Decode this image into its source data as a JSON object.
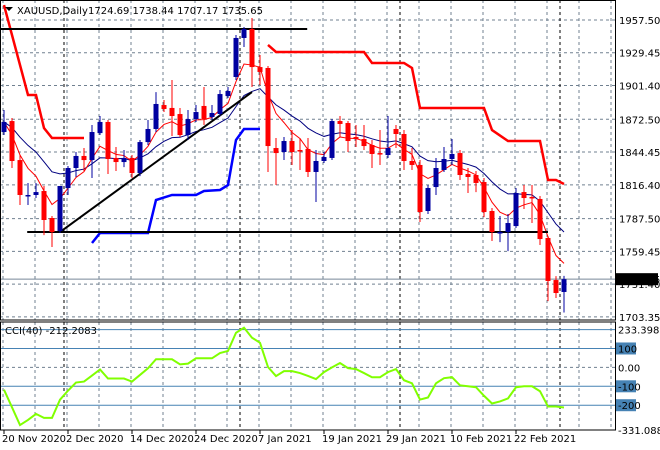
{
  "header": {
    "symbol_label": "XAUUSD,Daily",
    "ohlc": "1724.69 1738.44 1707.17 1735.65"
  },
  "colors": {
    "bull": "#0000a0",
    "bear": "#ff0000",
    "ma_fast": "#ff0000",
    "ma_slow": "#000080",
    "upper_band": "#ff0000",
    "lower_band": "#0000ff",
    "cci": "#80ff00",
    "cci_level": "#4682b4",
    "grid": "#708090"
  },
  "chart_data": [
    {
      "type": "candlestick",
      "title": "XAUUSD,Daily",
      "ylim": [
        1700.7,
        1974.6
      ],
      "y_ticks": [
        "1957.50",
        "1929.45",
        "1901.40",
        "1872.50",
        "1844.45",
        "1816.40",
        "1787.50",
        "1759.45",
        "1731.40",
        "1703.35"
      ],
      "current_price": "1735.65",
      "x_labels": [
        {
          "index": 0,
          "label": "20 Nov 2020"
        },
        {
          "index": 8,
          "label": "2 Dec 2020"
        },
        {
          "index": 16,
          "label": "14 Dec 2020"
        },
        {
          "index": 24,
          "label": "24 Dec 2020"
        },
        {
          "index": 32,
          "label": "7 Jan 2021"
        },
        {
          "index": 40,
          "label": "19 Jan 2021"
        },
        {
          "index": 48,
          "label": "29 Jan 2021"
        },
        {
          "index": 56,
          "label": "10 Feb 2021"
        },
        {
          "index": 64,
          "label": "22 Feb 2021"
        }
      ],
      "period_separators": [
        7,
        29,
        49,
        69
      ],
      "ohlc": [
        [
          1861.6,
          1880.4,
          1859.0,
          1870.2
        ],
        [
          1871.0,
          1873.6,
          1830.8,
          1836.8
        ],
        [
          1837.6,
          1841.9,
          1799.1,
          1807.7
        ],
        [
          1807.7,
          1818.0,
          1799.1,
          1807.7
        ],
        [
          1807.7,
          1818.0,
          1805.1,
          1810.2
        ],
        [
          1811.1,
          1815.4,
          1773.4,
          1786.3
        ],
        [
          1788.0,
          1789.7,
          1763.2,
          1776.0
        ],
        [
          1776.9,
          1815.4,
          1775.2,
          1815.4
        ],
        [
          1813.7,
          1832.5,
          1807.7,
          1830.8
        ],
        [
          1830.8,
          1844.5,
          1823.1,
          1841.1
        ],
        [
          1841.1,
          1847.9,
          1828.2,
          1837.6
        ],
        [
          1837.6,
          1867.6,
          1822.2,
          1861.6
        ],
        [
          1860.7,
          1875.3,
          1859.0,
          1870.2
        ],
        [
          1870.2,
          1871.9,
          1825.7,
          1838.5
        ],
        [
          1839.4,
          1848.8,
          1828.2,
          1835.9
        ],
        [
          1835.9,
          1846.2,
          1831.6,
          1839.4
        ],
        [
          1839.4,
          1841.9,
          1822.2,
          1826.5
        ],
        [
          1826.5,
          1854.8,
          1823.9,
          1853.0
        ],
        [
          1853.0,
          1871.9,
          1850.5,
          1864.2
        ],
        [
          1864.2,
          1895.8,
          1861.6,
          1885.6
        ],
        [
          1884.7,
          1889.0,
          1878.7,
          1881.3
        ],
        [
          1882.2,
          1906.1,
          1858.2,
          1875.3
        ],
        [
          1877.0,
          1882.2,
          1857.3,
          1859.0
        ],
        [
          1859.0,
          1880.4,
          1854.8,
          1872.7
        ],
        [
          1872.7,
          1884.7,
          1870.2,
          1878.7
        ],
        [
          1883.9,
          1900.1,
          1867.6,
          1872.7
        ],
        [
          1874.4,
          1884.7,
          1871.9,
          1877.9
        ],
        [
          1877.0,
          1897.6,
          1875.3,
          1894.1
        ],
        [
          1892.4,
          1900.1,
          1890.7,
          1896.7
        ],
        [
          1908.7,
          1944.6,
          1906.1,
          1942.1
        ],
        [
          1942.1,
          1951.5,
          1934.4,
          1949.8
        ],
        [
          1949.8,
          1959.2,
          1900.1,
          1917.2
        ],
        [
          1917.2,
          1927.5,
          1901.8,
          1913.0
        ],
        [
          1916.4,
          1918.1,
          1827.4,
          1849.6
        ],
        [
          1847.9,
          1856.5,
          1816.2,
          1843.6
        ],
        [
          1844.5,
          1857.3,
          1837.6,
          1853.9
        ],
        [
          1853.9,
          1863.3,
          1833.4,
          1844.5
        ],
        [
          1846.2,
          1856.5,
          1829.1,
          1845.4
        ],
        [
          1847.1,
          1856.5,
          1823.1,
          1827.4
        ],
        [
          1827.4,
          1846.2,
          1801.7,
          1836.8
        ],
        [
          1836.8,
          1844.5,
          1835.1,
          1840.2
        ],
        [
          1839.4,
          1872.7,
          1837.6,
          1871.0
        ],
        [
          1871.0,
          1875.3,
          1857.3,
          1868.5
        ],
        [
          1869.3,
          1871.0,
          1844.5,
          1853.9
        ],
        [
          1857.3,
          1867.6,
          1848.8,
          1855.6
        ],
        [
          1855.6,
          1867.6,
          1846.2,
          1849.6
        ],
        [
          1850.5,
          1854.8,
          1830.8,
          1842.8
        ],
        [
          1843.6,
          1863.3,
          1833.4,
          1842.8
        ],
        [
          1841.9,
          1875.3,
          1839.4,
          1847.9
        ],
        [
          1864.2,
          1867.6,
          1847.9,
          1859.9
        ],
        [
          1859.9,
          1863.3,
          1829.1,
          1836.8
        ],
        [
          1836.8,
          1847.9,
          1829.1,
          1833.4
        ],
        [
          1833.4,
          1837.6,
          1784.6,
          1793.1
        ],
        [
          1794.0,
          1816.2,
          1791.4,
          1813.7
        ],
        [
          1814.5,
          1839.4,
          1807.7,
          1830.8
        ],
        [
          1829.1,
          1848.8,
          1827.4,
          1838.5
        ],
        [
          1838.5,
          1855.6,
          1833.4,
          1842.8
        ],
        [
          1843.6,
          1846.2,
          1820.5,
          1824.8
        ],
        [
          1825.7,
          1830.8,
          1809.4,
          1823.1
        ],
        [
          1824.8,
          1828.2,
          1810.2,
          1818.0
        ],
        [
          1818.8,
          1822.2,
          1788.8,
          1793.1
        ],
        [
          1794.0,
          1796.6,
          1768.3,
          1776.0
        ],
        [
          1776.0,
          1789.7,
          1767.4,
          1776.0
        ],
        [
          1776.0,
          1791.4,
          1759.7,
          1783.7
        ],
        [
          1781.1,
          1813.7,
          1779.4,
          1809.4
        ],
        [
          1810.2,
          1816.2,
          1795.7,
          1805.1
        ],
        [
          1806.0,
          1816.2,
          1783.7,
          1805.1
        ],
        [
          1804.3,
          1806.8,
          1764.9,
          1770.0
        ],
        [
          1770.9,
          1772.6,
          1716.9,
          1734.1
        ],
        [
          1734.9,
          1738.3,
          1719.5,
          1723.8
        ],
        [
          1724.69,
          1738.44,
          1707.17,
          1735.65
        ]
      ],
      "upper_band": [
        [
          [
            0,
            1970.3
          ],
          [
            3,
            1893.3
          ],
          [
            4,
            1893.3
          ],
          [
            5,
            1865.0
          ],
          [
            6,
            1856.5
          ],
          [
            10,
            1856.5
          ]
        ],
        [
          [
            33,
            1936.1
          ],
          [
            34,
            1930.1
          ],
          [
            45,
            1930.1
          ],
          [
            46,
            1920.7
          ],
          [
            50,
            1920.7
          ],
          [
            51,
            1916.4
          ],
          [
            52,
            1882.2
          ],
          [
            60,
            1882.2
          ],
          [
            61,
            1863.3
          ],
          [
            63,
            1853.9
          ],
          [
            67,
            1853.9
          ],
          [
            68,
            1820.5
          ],
          [
            69,
            1820.5
          ],
          [
            70,
            1817.1
          ]
        ]
      ],
      "lower_band": [
        [
          11,
          1766.6
        ],
        [
          12,
          1775.2
        ],
        [
          18,
          1775.2
        ],
        [
          19,
          1803.4
        ],
        [
          21,
          1807.7
        ],
        [
          24,
          1807.7
        ],
        [
          25,
          1811.1
        ],
        [
          27,
          1812.0
        ],
        [
          28,
          1816.2
        ],
        [
          29,
          1854.8
        ],
        [
          30,
          1864.2
        ],
        [
          32,
          1864.2
        ]
      ],
      "horizontal_lines": [
        {
          "price": 1949.8,
          "from": -1,
          "to": 37.9
        },
        {
          "price": 1776.0,
          "from": 2.9,
          "to": 68
        }
      ],
      "trend_line": [
        [
          7,
          1776.0
        ],
        [
          31,
          1895.8
        ]
      ]
    },
    {
      "type": "line",
      "title": "CCI(40) -212.2083",
      "ylim": [
        -331.088,
        240
      ],
      "y_ticks": [
        "233.3982",
        "100",
        "0.00",
        "-100",
        "-200",
        "-331.088"
      ],
      "levels": [
        200,
        100,
        -100,
        -200
      ],
      "values": [
        -118,
        -211,
        -305,
        -278,
        -246,
        -267,
        -267,
        -171,
        -123,
        -80,
        -75,
        -43,
        -11,
        -59,
        -59,
        -59,
        -75,
        -40,
        -5,
        43,
        43,
        43,
        16,
        20,
        48,
        48,
        48,
        76,
        87,
        183,
        210,
        157,
        130,
        2,
        -46,
        -20,
        -20,
        -30,
        -45,
        -62,
        -25,
        0,
        23,
        -4,
        -9,
        -30,
        -52,
        -52,
        -25,
        -9,
        -68,
        -84,
        -170,
        -159,
        -84,
        -57,
        -52,
        -95,
        -100,
        -105,
        -150,
        -191,
        -180,
        -164,
        -105,
        -100,
        -100,
        -126,
        -207,
        -207,
        -212.2083
      ]
    }
  ]
}
